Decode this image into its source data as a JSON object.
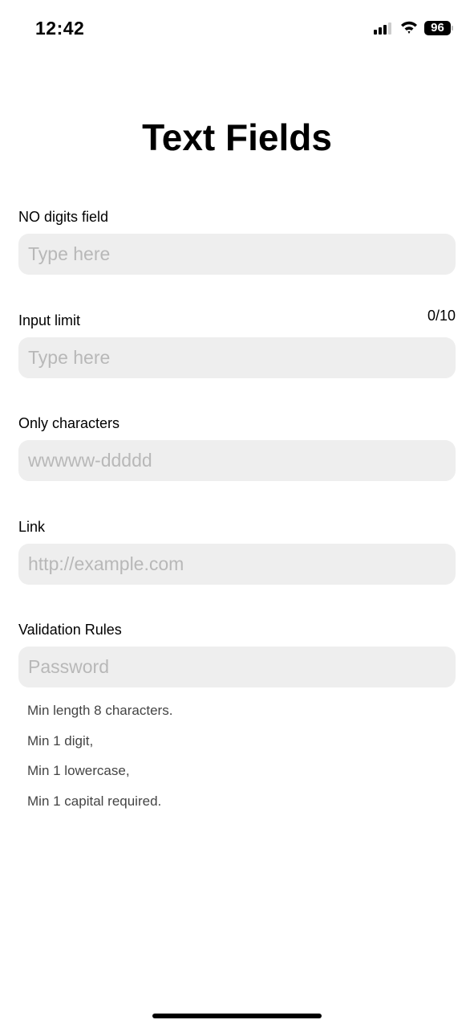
{
  "status_bar": {
    "time": "12:42",
    "battery": "96",
    "signal_bars": 3,
    "icons": [
      "signal-icon",
      "wifi-icon",
      "battery-icon"
    ]
  },
  "page": {
    "title": "Text Fields"
  },
  "fields": [
    {
      "label": "NO digits field",
      "placeholder": "Type here",
      "value": ""
    },
    {
      "label": "Input limit",
      "counter": "0/10",
      "placeholder": "Type here",
      "value": ""
    },
    {
      "label": "Only characters",
      "placeholder": "wwwww-ddddd",
      "value": ""
    },
    {
      "label": "Link",
      "placeholder": "http://example.com",
      "value": ""
    },
    {
      "label": "Validation Rules",
      "placeholder": "Password",
      "value": ""
    }
  ],
  "rules": [
    "Min length 8 characters.",
    "Min 1 digit,",
    "Min 1 lowercase,",
    "Min 1 capital required."
  ]
}
